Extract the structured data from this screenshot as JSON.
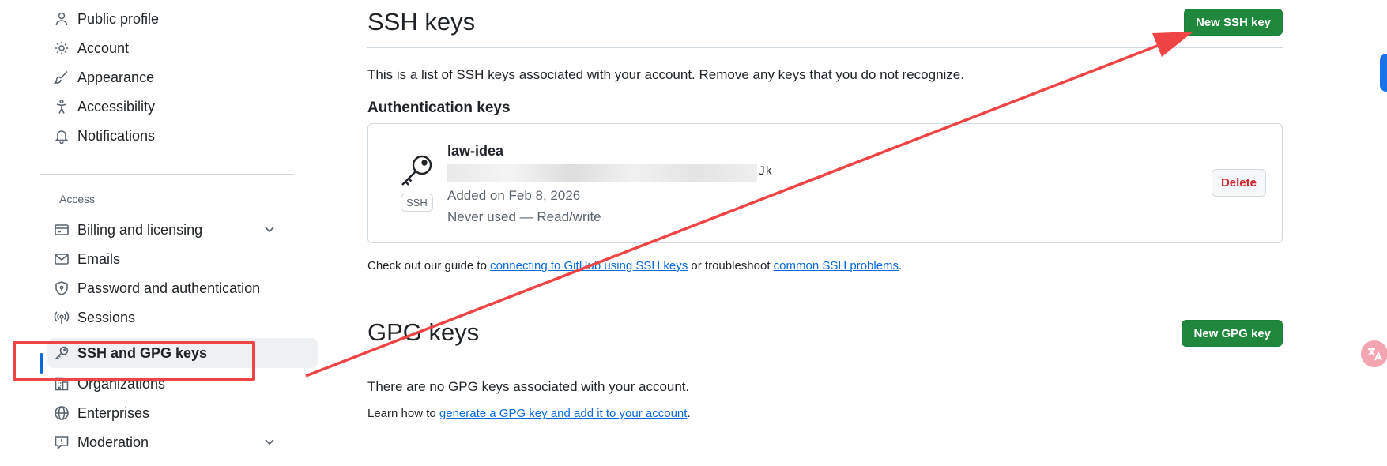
{
  "sidebar": {
    "items_top": [
      {
        "label": "Public profile",
        "icon": "person-icon"
      },
      {
        "label": "Account",
        "icon": "gear-icon"
      },
      {
        "label": "Appearance",
        "icon": "paintbrush-icon"
      },
      {
        "label": "Accessibility",
        "icon": "accessibility-icon"
      },
      {
        "label": "Notifications",
        "icon": "bell-icon"
      }
    ],
    "access_label": "Access",
    "items_access": [
      {
        "label": "Billing and licensing",
        "icon": "credit-card-icon",
        "expandable": true
      },
      {
        "label": "Emails",
        "icon": "mail-icon"
      },
      {
        "label": "Password and authentication",
        "icon": "shield-lock-icon"
      },
      {
        "label": "Sessions",
        "icon": "broadcast-icon"
      },
      {
        "label": "SSH and GPG keys",
        "icon": "key-icon",
        "active": true
      },
      {
        "label": "Organizations",
        "icon": "organization-icon"
      },
      {
        "label": "Enterprises",
        "icon": "globe-icon"
      },
      {
        "label": "Moderation",
        "icon": "report-icon",
        "expandable": true
      }
    ]
  },
  "ssh": {
    "title": "SSH keys",
    "new_button": "New SSH key",
    "description": "This is a list of SSH keys associated with your account. Remove any keys that you do not recognize.",
    "auth_heading": "Authentication keys",
    "key": {
      "name": "law-idea",
      "badge": "SSH",
      "fingerprint_visible": "Jk",
      "added": "Added on Feb 8, 2026",
      "usage": "Never used — Read/write",
      "delete_label": "Delete"
    },
    "guide": {
      "prefix": "Check out our guide to ",
      "link1": "connecting to GitHub using SSH keys",
      "middle": " or troubleshoot ",
      "link2": "common SSH problems",
      "suffix": "."
    }
  },
  "gpg": {
    "title": "GPG keys",
    "new_button": "New GPG key",
    "empty": "There are no GPG keys associated with your account.",
    "learn_prefix": "Learn how to ",
    "learn_link": "generate a GPG key and add it to your account",
    "learn_suffix": "."
  },
  "colors": {
    "accent_blue": "#0969da",
    "primary_green": "#1f883d",
    "danger_red": "#d1242f",
    "annotation_red": "#ef4444"
  }
}
